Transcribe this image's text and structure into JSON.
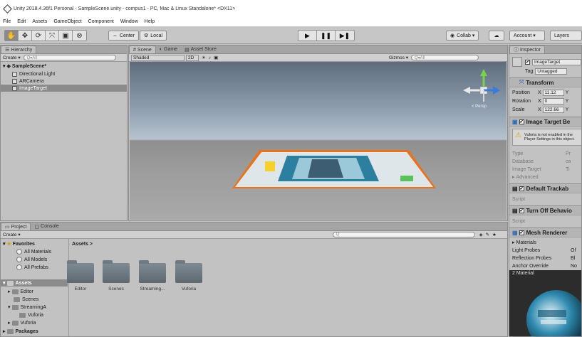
{
  "window": {
    "title": "Unity 2018.4.36f1 Personal - SampleScene.unity - compus1 - PC, Mac & Linux Standalone* <DX11>"
  },
  "menu": [
    "File",
    "Edit",
    "Assets",
    "GameObject",
    "Component",
    "Window",
    "Help"
  ],
  "toolbar": {
    "tools": [
      "✋",
      "✥",
      "⟳",
      "⤧",
      "▣",
      "⊗"
    ],
    "pivot_label": "Center",
    "space_label": "Local",
    "play_icons": [
      "▶",
      "❚❚",
      "▶❚"
    ],
    "collab_label": "Collab ▾",
    "cloud_icon": "cloud-icon",
    "account_label": "Account ▾",
    "layers_label": "Layers"
  },
  "hierarchy": {
    "tab": "Hierarchy",
    "create_label": "Create ▾",
    "search_placeholder": "Q▾All",
    "scene_name": "SampleScene*",
    "items": [
      {
        "label": "Directional Light"
      },
      {
        "label": "ARCamera"
      },
      {
        "label": "ImageTarget"
      }
    ]
  },
  "scene": {
    "tabs": [
      "Scene",
      "Game",
      "Asset Store"
    ],
    "shading_mode": "Shaded",
    "mode_2d": "2D",
    "gizmos_label": "Gizmos ▾",
    "search_placeholder": "Q▾All",
    "gizmo_label": "< Persp"
  },
  "inspector": {
    "tab": "Inspector",
    "object_name": "ImageTarget",
    "tag_label": "Tag",
    "tag_value": "Untagged",
    "transform": {
      "title": "Transform",
      "rows": [
        {
          "label": "Position",
          "x": "11.12",
          "y": "Y"
        },
        {
          "label": "Rotation",
          "x": "0",
          "y": "Y"
        },
        {
          "label": "Scale",
          "x": "122.66",
          "y": "Y"
        }
      ]
    },
    "image_target": {
      "title": "Image Target Be",
      "warning": "Vuforia is not enabled in the Player Settings in this object.",
      "fields": [
        {
          "label": "Type",
          "value": "Pr"
        },
        {
          "label": "Database",
          "value": "ca"
        },
        {
          "label": "Image Target",
          "value": "Ti"
        }
      ],
      "advanced_label": "Advanced"
    },
    "default_trackable": {
      "title": "Default Trackab",
      "script_label": "Script"
    },
    "turn_off": {
      "title": "Turn Off Behavio",
      "script_label": "Script"
    },
    "mesh_renderer": {
      "title": "Mesh Renderer",
      "materials_label": "Materials",
      "rows": [
        {
          "label": "Light Probes",
          "value": "Of"
        },
        {
          "label": "Reflection Probes",
          "value": "Bl"
        },
        {
          "label": "Anchor Override",
          "value": "No"
        }
      ]
    },
    "preview_label": "2 Material",
    "preview_icon": "sphere-preview-icon"
  },
  "project": {
    "tabs": [
      "Project",
      "Console"
    ],
    "create_label": "Create ▾",
    "search_placeholder": "Q",
    "favorites_label": "Favorites",
    "favorites": [
      "All Materials",
      "All Models",
      "All Prefabs"
    ],
    "assets_label": "Assets",
    "tree": [
      "Editor",
      "Scenes",
      "StreamingA",
      "Vuforia",
      "Vuforia"
    ],
    "packages_label": "Packages",
    "breadcrumb": "Assets >",
    "folders": [
      "Editor",
      "Scenes",
      "Streaming...",
      "Vuforia"
    ]
  },
  "colors": {
    "selection": "#8b8b8b",
    "target_outline": "#e8731f",
    "panel_bg": "#c2c2c2"
  }
}
